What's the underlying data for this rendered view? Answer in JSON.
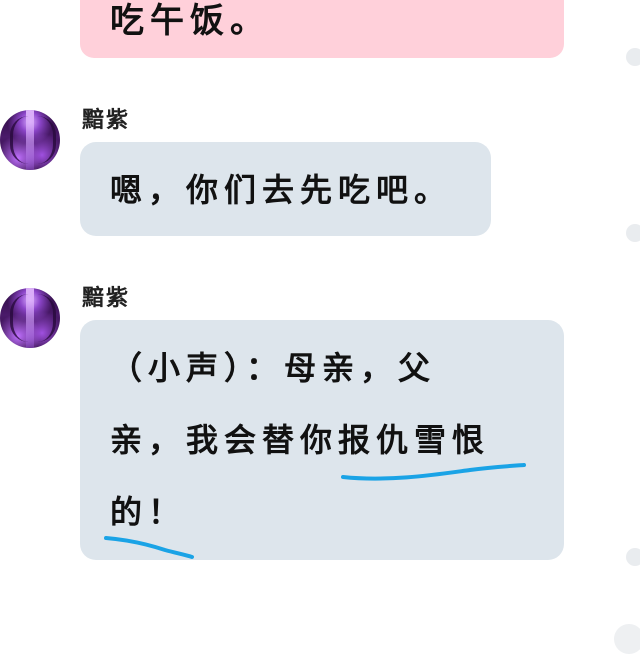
{
  "messages": [
    {
      "side": "right",
      "color": "#ffd0da",
      "text": "吃午饭。"
    },
    {
      "sender": "黯紫",
      "avatar": "purple-forest-avatar",
      "color": "#dde5ec",
      "text": "嗯，你们去先吃吧。"
    },
    {
      "sender": "黯紫",
      "avatar": "purple-forest-avatar",
      "color": "#dde5ec",
      "lines": [
        "（小声）：母亲，父",
        "亲，我会替你报仇雪恨",
        "的！"
      ]
    }
  ],
  "annotations": {
    "underline_color": "#1aa3e6"
  }
}
